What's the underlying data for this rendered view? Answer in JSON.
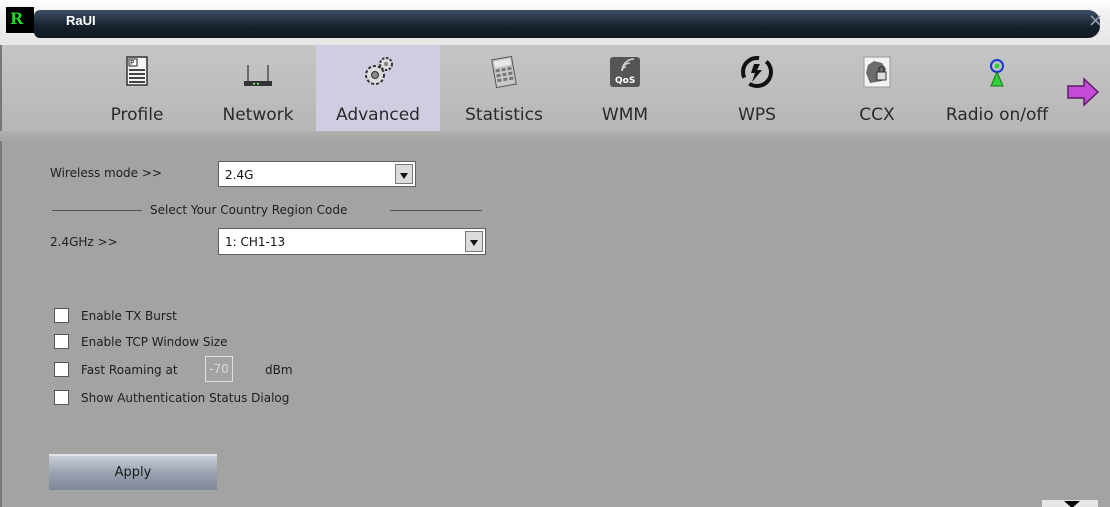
{
  "window": {
    "title": "RaUI",
    "logo_letter": "R",
    "close_glyph": "×"
  },
  "toolbar": {
    "items": [
      {
        "label": "Profile",
        "icon": "profile-document-icon"
      },
      {
        "label": "Network",
        "icon": "network-router-icon"
      },
      {
        "label": "Advanced",
        "icon": "gears-icon",
        "active": true
      },
      {
        "label": "Statistics",
        "icon": "calculator-icon"
      },
      {
        "label": "WMM",
        "icon": "qos-icon",
        "badge": "QoS"
      },
      {
        "label": "WPS",
        "icon": "wps-icon"
      },
      {
        "label": "CCX",
        "icon": "ccx-lock-icon"
      },
      {
        "label": "Radio on/off",
        "icon": "radio-antenna-icon"
      }
    ],
    "next_icon": "next-arrow-icon",
    "active_bg": "#d0cde1"
  },
  "form": {
    "wireless_mode_label": "Wireless mode >>",
    "wireless_mode_value": "2.4G",
    "country_section_title": "Select Your Country Region Code",
    "band_label": "2.4GHz >>",
    "band_value": "1: CH1-13",
    "checkboxes": {
      "tx_burst": "Enable TX Burst",
      "tcp_window": "Enable TCP Window Size",
      "fast_roaming": "Fast Roaming at",
      "auth_dialog": "Show Authentication Status Dialog"
    },
    "roaming_value": "-70",
    "roaming_unit": "dBm",
    "apply_label": "Apply"
  },
  "colors": {
    "content_bg": "#a3a3a3",
    "title_bar": "#16202d",
    "logo_green": "#25d626"
  }
}
